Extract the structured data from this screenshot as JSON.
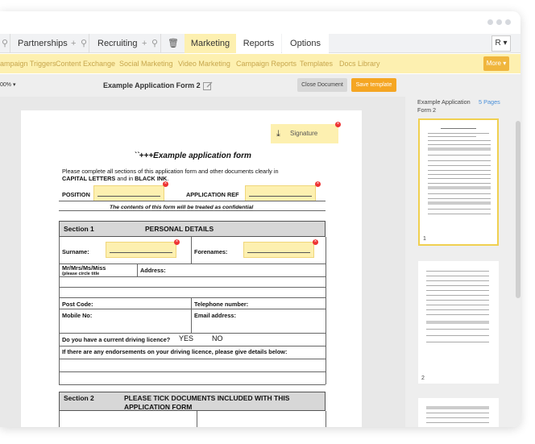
{
  "tabs": {
    "partnerships": "Partnerships",
    "recruiting": "Recruiting",
    "marketing": "Marketing",
    "reports": "Reports",
    "options": "Options",
    "user_initial": "R ▾"
  },
  "subnav": {
    "items": [
      "ampaign Triggers",
      "Content Exchange",
      "Social Marketing",
      "Video Marketing",
      "Campaign Reports",
      "Templates",
      "Docs Library"
    ],
    "more": "More ▾"
  },
  "toolbar": {
    "zoom": "00% ▾",
    "doc_title": "Example Application Form 2",
    "close_label": "Close Document",
    "save_label": "Save template"
  },
  "document": {
    "signature_label": "Signature",
    "form_title": "``+++Example application form",
    "intro_line1": "Please complete all sections of this application form and other documents clearly in",
    "intro_line2a": "CAPITAL LETTERS",
    "intro_line2b": " and in ",
    "intro_line2c": "BLACK INK",
    "intro_line2d": ".",
    "position_label": "POSITION",
    "app_ref_label": "APPLICATION REF",
    "confidential": "The contents of this form will be treated as confidential",
    "section1": {
      "num": "Section 1",
      "title": "PERSONAL DETAILS"
    },
    "surname": "Surname:",
    "forenames": "Forenames:",
    "title_label": "Mr/Mrs/Ms/Miss",
    "title_hint": "(please circle title",
    "address": "Address:",
    "postcode": "Post Code:",
    "telephone": "Telephone number:",
    "mobile": "Mobile No:",
    "email": "Email address:",
    "licence_q": "Do you have a current driving licence?",
    "yes": "YES",
    "no": "NO",
    "endorse_q": "If there are any endorsements on your driving licence, please give details below:",
    "section2": {
      "num": "Section 2",
      "title": "PLEASE TICK DOCUMENTS INCLUDED WITH THIS APPLICATION FORM"
    }
  },
  "pages_panel": {
    "doc_name": "Example Application Form 2",
    "page_count": "5 Pages",
    "thumbs": [
      "1",
      "2"
    ]
  }
}
